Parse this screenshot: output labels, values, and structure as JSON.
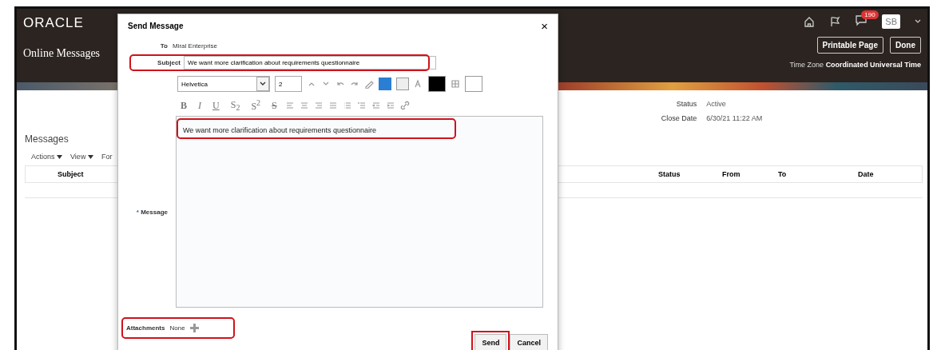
{
  "header": {
    "logo": "ORACLE",
    "title": "Online Messages",
    "notification_count": "190",
    "avatar": "SB",
    "buttons": [
      "Printable Page",
      "Done"
    ],
    "time_zone_label": "Time Zone",
    "time_zone": "Coordinated Universal Time"
  },
  "details": [
    {
      "label": "Status",
      "value": "Active"
    },
    {
      "label": "Close Date",
      "value": "6/30/21 11:22 AM"
    }
  ],
  "messages": {
    "title": "Messages",
    "menus": [
      "Actions",
      "View",
      "For"
    ],
    "columns": [
      "Subject",
      "Status",
      "From",
      "To",
      "Date"
    ]
  },
  "dialog": {
    "title": "Send Message",
    "close": "×",
    "to_label": "To",
    "to": "Miral Enterprise",
    "subject_label": "Subject",
    "subject": "We want more clarification about requirements questionnaire",
    "subject_highlighted": true,
    "toolbar": {
      "font": "Helvetica",
      "size": "2",
      "view_toggles": [
        {
          "selected": true
        },
        {
          "selected": false
        }
      ],
      "format_buttons": [
        {
          "label": "B",
          "kind": "bold"
        },
        {
          "label": "I",
          "kind": "italic"
        },
        {
          "label": "U",
          "kind": "underline"
        },
        {
          "label": "S$_{2}$",
          "kind": "plain"
        },
        {
          "label": "S$^{2}$",
          "kind": "plain"
        },
        {
          "label": "S",
          "kind": "strike"
        }
      ]
    },
    "message_label": "Message",
    "message_required_mark": "*",
    "message": "We want more clarification about requirements questionnaire",
    "message_highlighted": true,
    "attachments_label": "Attachments",
    "attachments": "None",
    "attachments_highlighted": true,
    "buttons": [
      {
        "label": "Send",
        "highlighted": true
      },
      {
        "label": "Cancel",
        "highlighted": false
      }
    ]
  }
}
